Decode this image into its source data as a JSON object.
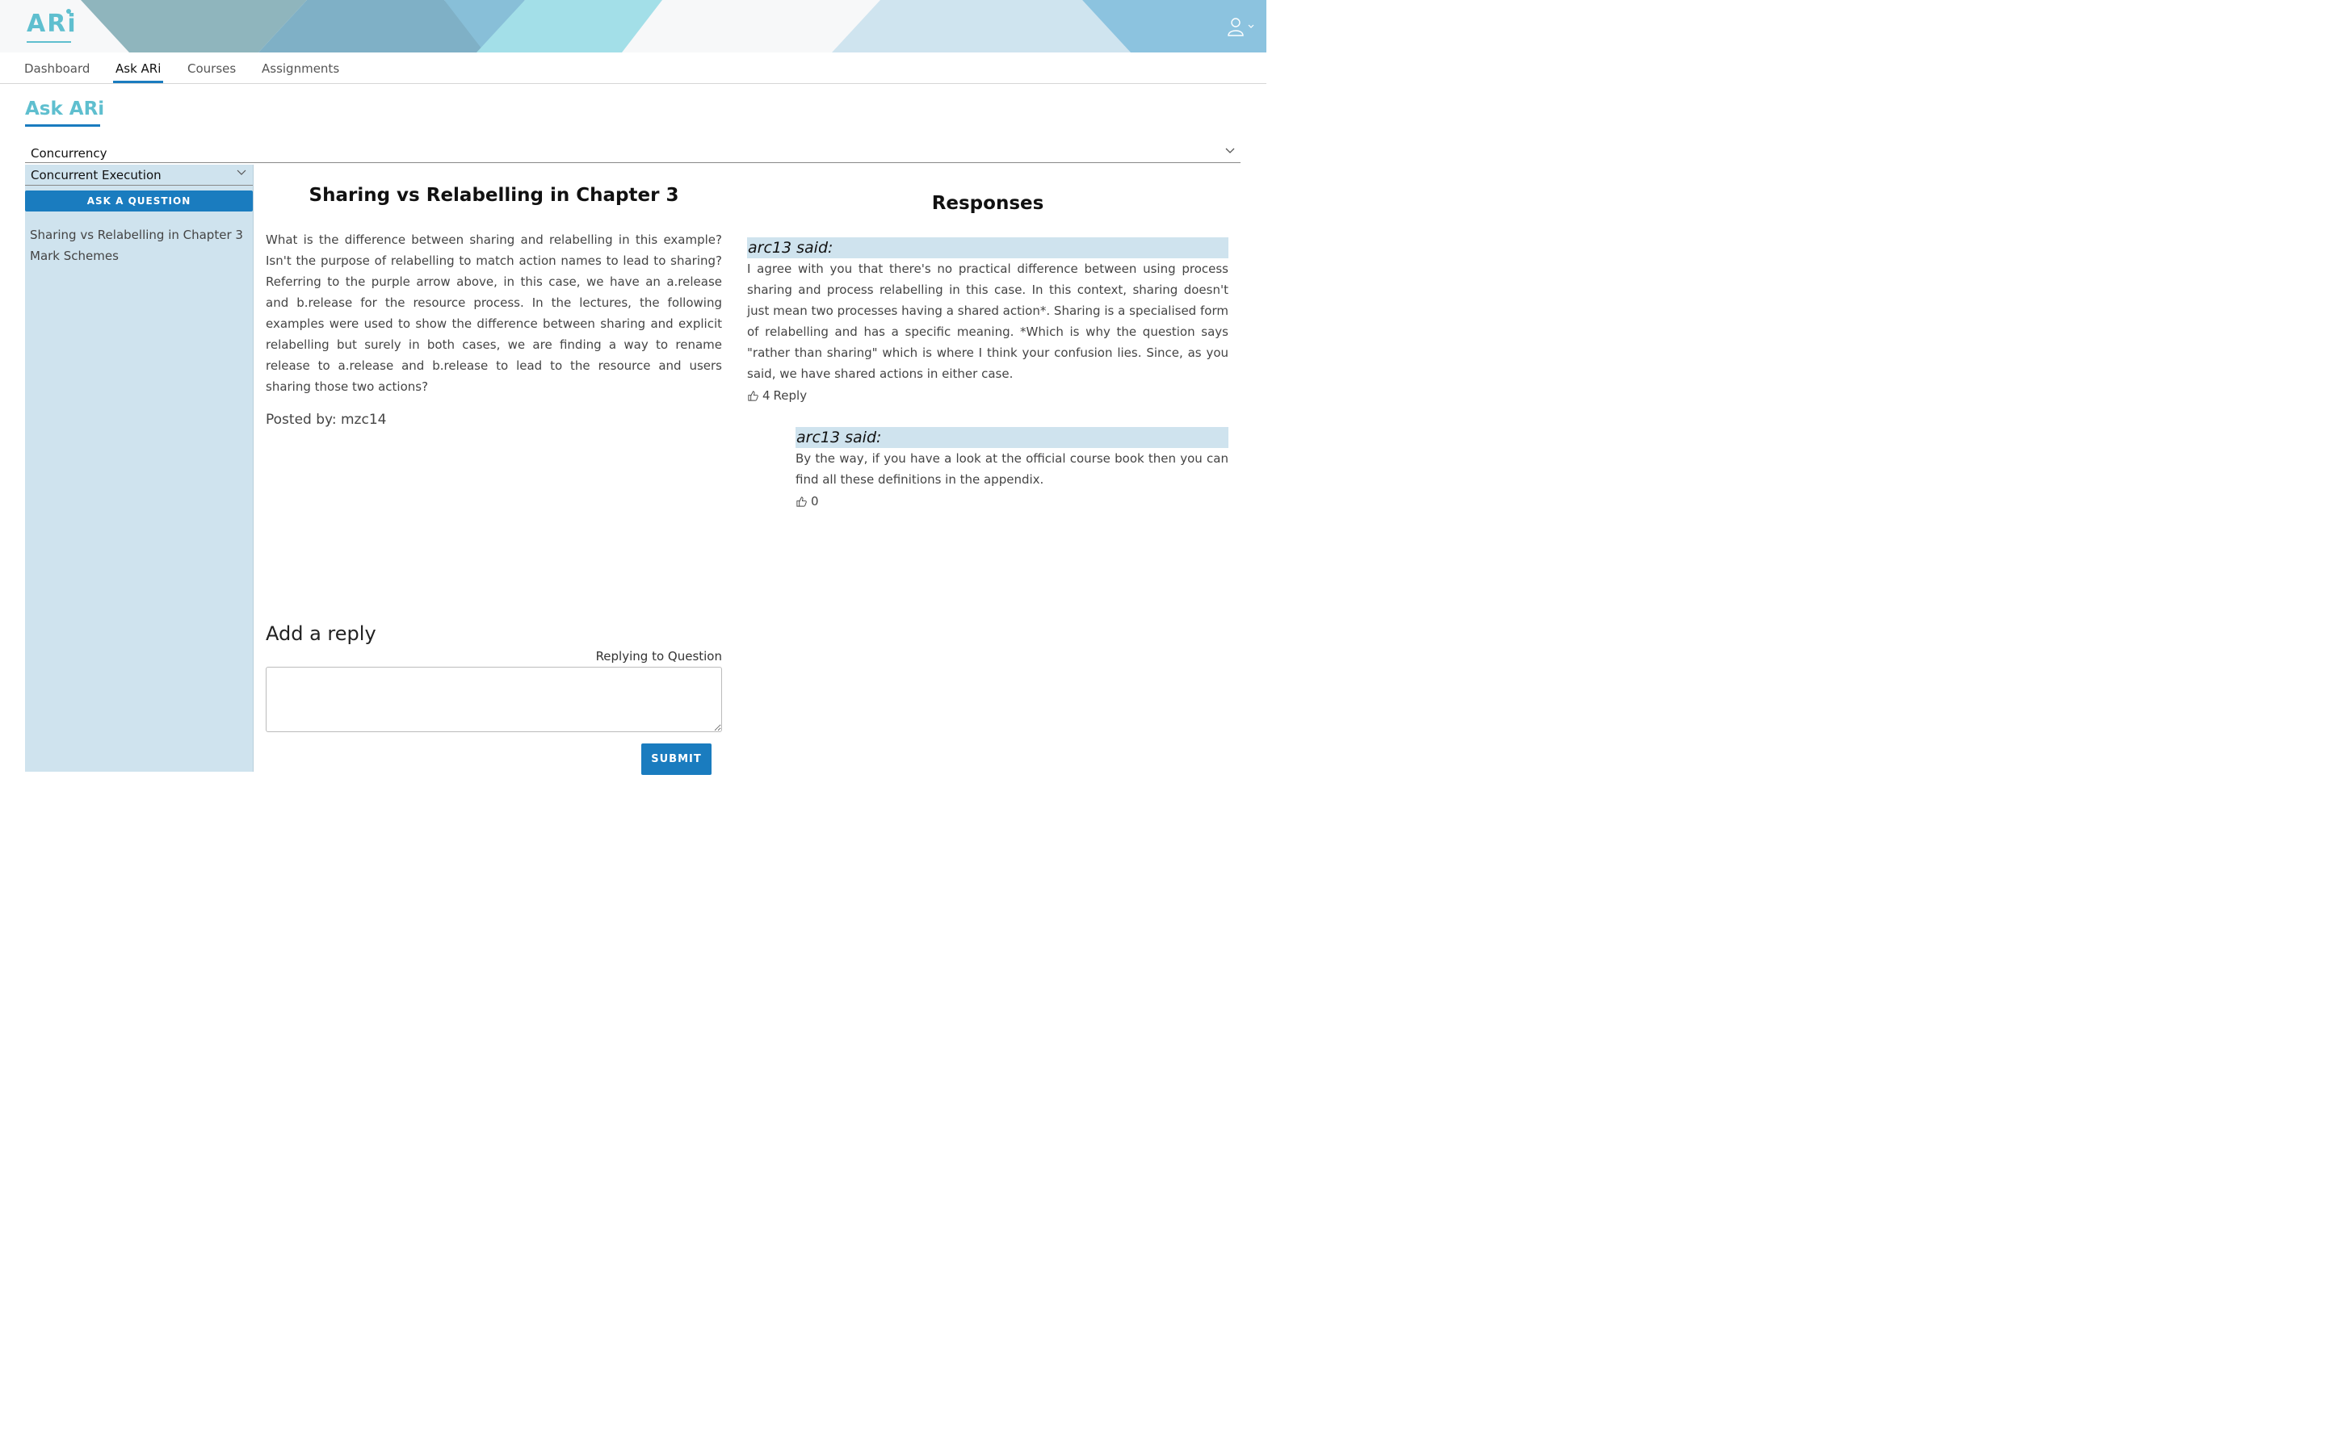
{
  "app": {
    "logo": "ARi"
  },
  "nav": {
    "tabs": [
      {
        "label": "Dashboard"
      },
      {
        "label": "Ask ARi"
      },
      {
        "label": "Courses"
      },
      {
        "label": "Assignments"
      }
    ],
    "active_tab": "Ask ARi"
  },
  "page": {
    "title": "Ask ARi"
  },
  "course_select": {
    "value": "Concurrency"
  },
  "sidebar": {
    "topic_select": {
      "value": "Concurrent Execution"
    },
    "ask_button": "ASK A QUESTION",
    "questions": [
      {
        "label": "Sharing vs Relabelling in Chapter 3"
      },
      {
        "label": "Mark Schemes"
      }
    ]
  },
  "question": {
    "title": "Sharing vs Relabelling in Chapter 3",
    "body": "What is the difference between sharing and relabelling in this example? Isn't the purpose of relabelling to match action names to lead to sharing? Referring to the purple arrow above, in this case, we have an a.release and b.release for the resource process. In the lectures, the following examples were used to show the difference between sharing and explicit relabelling but surely in both cases, we are finding a way to rename release to a.release and b.release to lead to the resource and users sharing those two actions?",
    "posted_by_label": "Posted by:",
    "posted_by": "mzc14"
  },
  "reply_form": {
    "heading": "Add a reply",
    "replying_to": "Replying to Question",
    "placeholder": "",
    "submit": "SUBMIT"
  },
  "responses": {
    "title": "Responses",
    "items": [
      {
        "author_line": "arc13 said:",
        "body": "I agree with you that there's no practical difference between using process sharing and process relabelling in this case.   In this context, sharing doesn't just mean two processes having a shared action*. Sharing is a specialised form of relabelling and has a specific meaning.  *Which is why the question says \"rather than sharing\" which is where I think your confusion lies. Since, as you said, we have shared actions in either case.",
        "likes": "4",
        "reply_label": "Reply"
      },
      {
        "author_line": "arc13 said:",
        "body": "By the way, if you have a look at the official course book then you can find all these definitions in the appendix.",
        "likes": "0"
      }
    ]
  },
  "colors": {
    "accent": "#1a7cbf",
    "brand": "#5fbfcf",
    "sidebar_bg": "#cfe3ee"
  },
  "icons": {
    "user": "user-icon",
    "chevron": "chevron-down-icon",
    "like": "thumbs-up-icon"
  }
}
